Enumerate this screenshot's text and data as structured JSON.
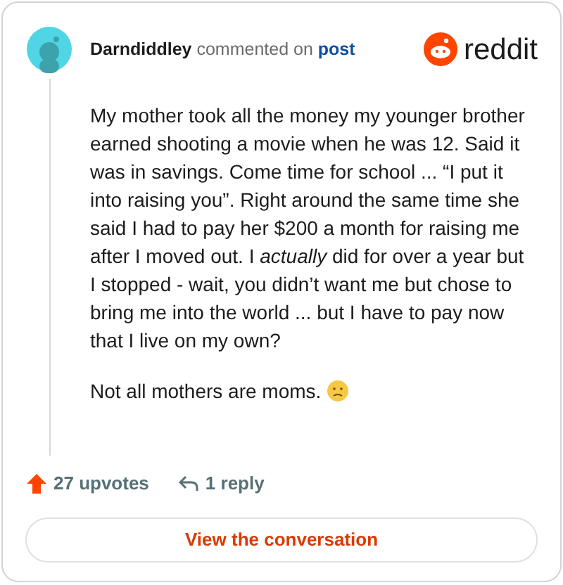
{
  "comment": {
    "author": "Darndiddley",
    "action": "commented on",
    "target": "post",
    "paragraphs": [
      "My mother took all the money my younger brother earned shooting a movie when he was 12. Said it was in savings. Come time for school ... “I put it into raising you”. Right around the same time she said I had to pay her $200 a month for raising me after I moved out. I *actually* did for over a year but I stopped - wait, you didn’t want me but chose to bring me into the world ... but I have to pay now that I live on my own?",
      "Not all mothers are moms."
    ]
  },
  "brand": {
    "name": "reddit"
  },
  "stats": {
    "upvotes": "27 upvotes",
    "replies": "1 reply"
  },
  "button": {
    "label": "View the conversation"
  }
}
